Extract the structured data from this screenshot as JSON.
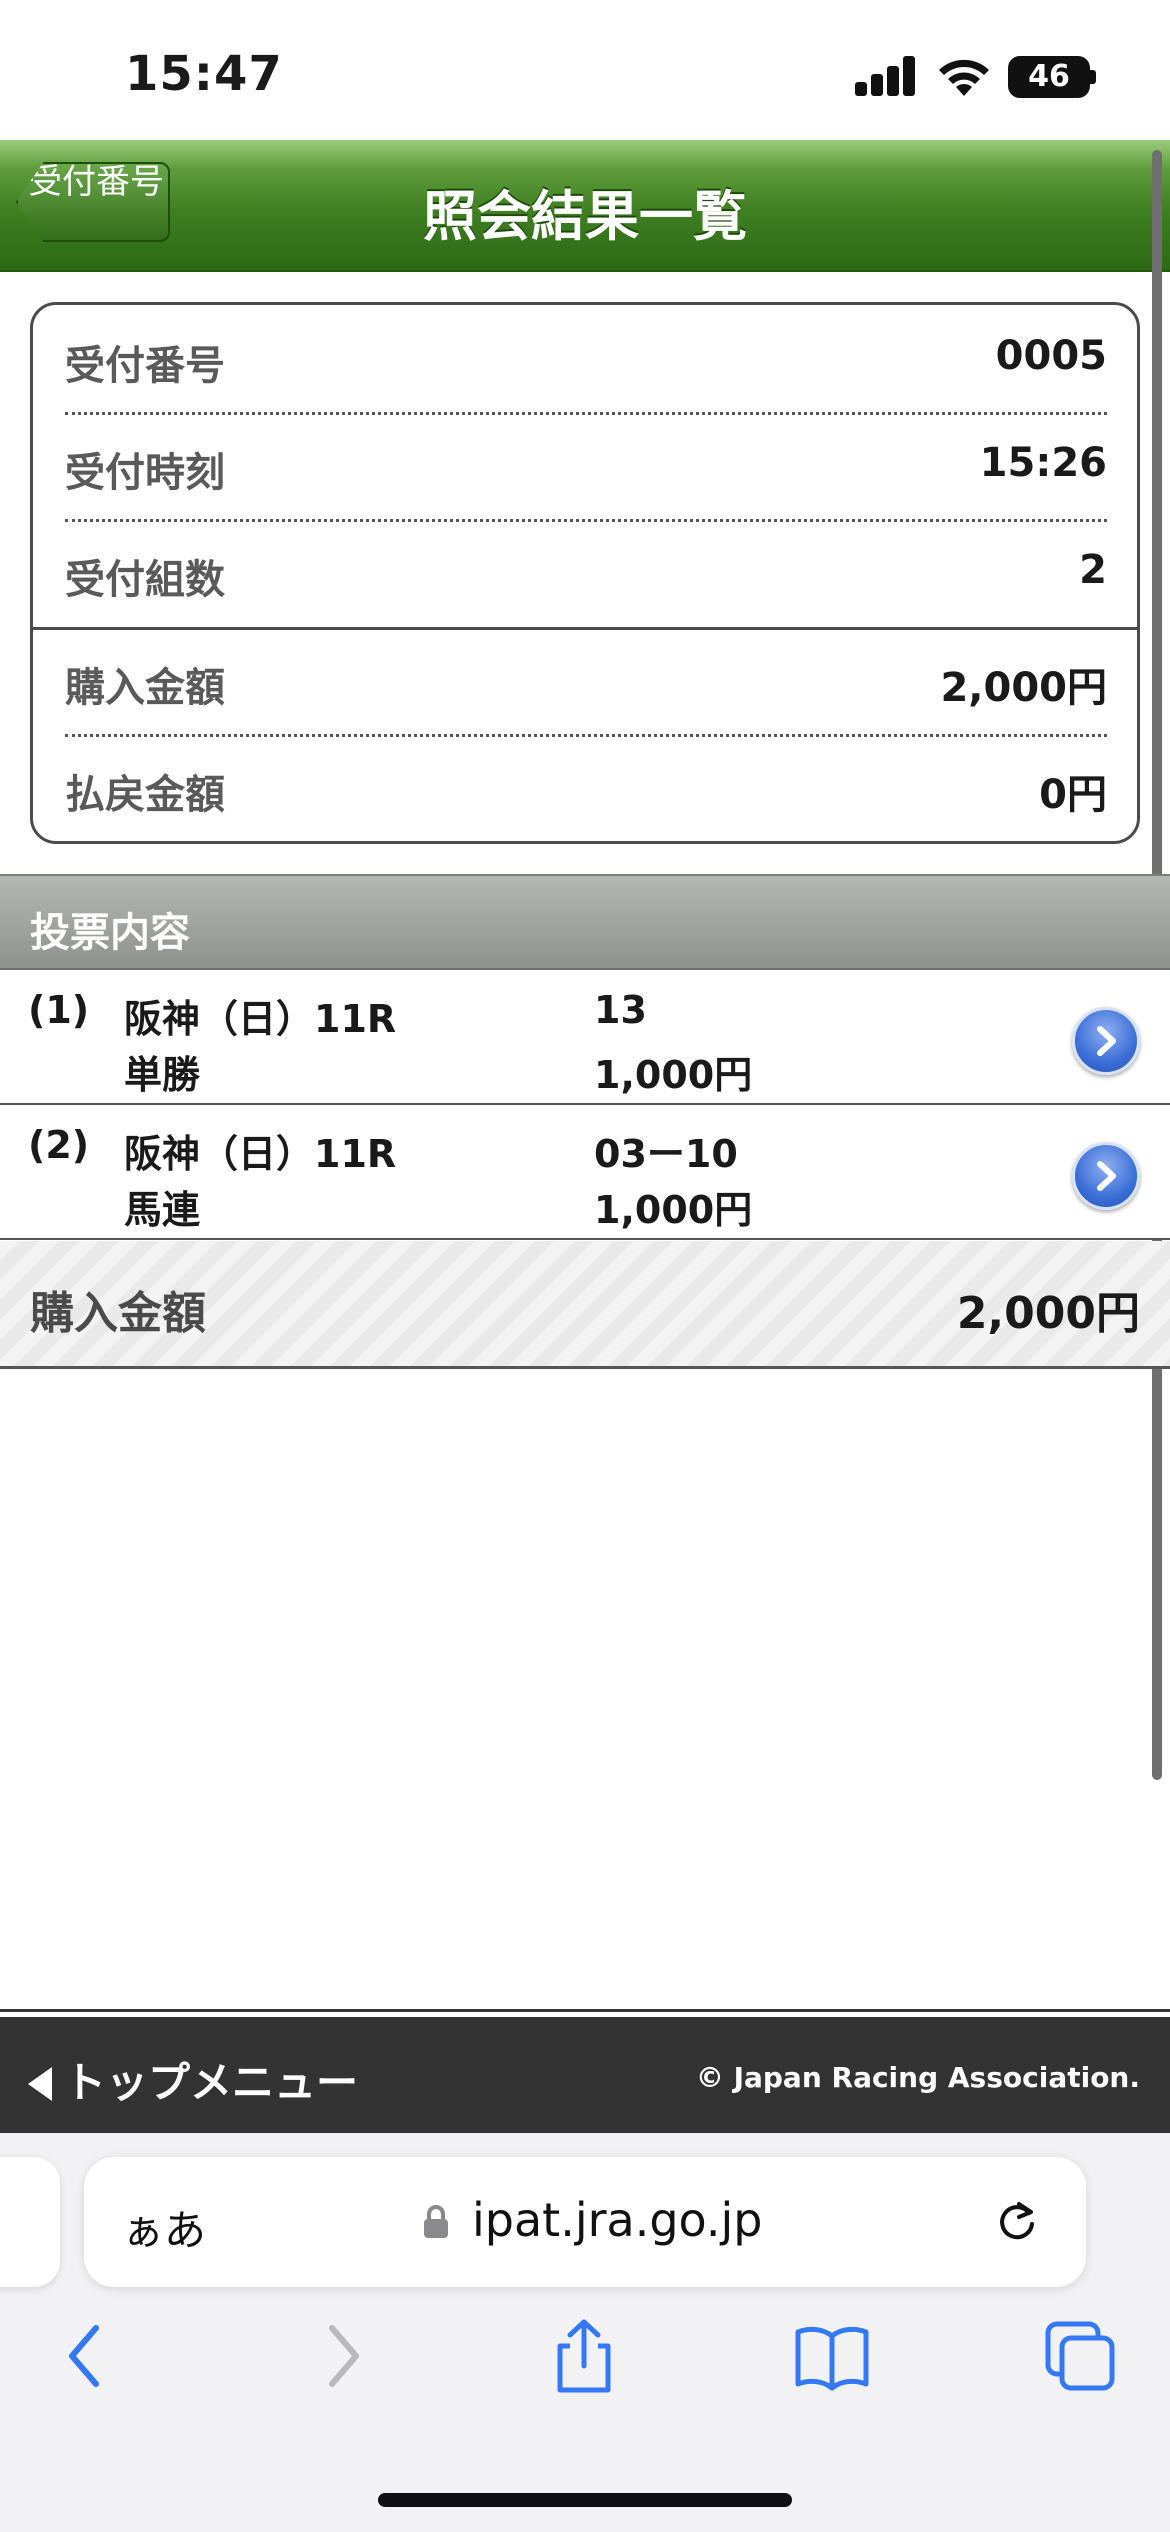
{
  "status_bar": {
    "time": "15:47",
    "battery": "46"
  },
  "header": {
    "back_label": "受付番号",
    "title": "照会結果一覧"
  },
  "summary": {
    "rows": [
      {
        "label": "受付番号",
        "value": "0005"
      },
      {
        "label": "受付時刻",
        "value": "15:26"
      },
      {
        "label": "受付組数",
        "value": "2"
      },
      {
        "label": "購入金額",
        "value": "2,000円"
      },
      {
        "label": "払戻金額",
        "value": "0円"
      }
    ]
  },
  "vote_section": {
    "title": "投票内容"
  },
  "bets": [
    {
      "num": "(1)",
      "venue": "阪神（日）11R",
      "type": "単勝",
      "combo": "13",
      "amount": "1,000円"
    },
    {
      "num": "(2)",
      "venue": "阪神（日）11R",
      "type": "馬連",
      "combo": "03ー10",
      "amount": "1,000円"
    }
  ],
  "total": {
    "label": "購入金額",
    "value": "2,000円"
  },
  "footer": {
    "top_menu": "トップメニュー",
    "copyright": "© Japan Racing Association."
  },
  "browser": {
    "aa": "ぁあ",
    "url": "ipat.jra.go.jp"
  },
  "colors": {
    "header_green": "#3f7f22",
    "accent_blue": "#3c6fd8",
    "safari_blue": "#3478f6"
  }
}
